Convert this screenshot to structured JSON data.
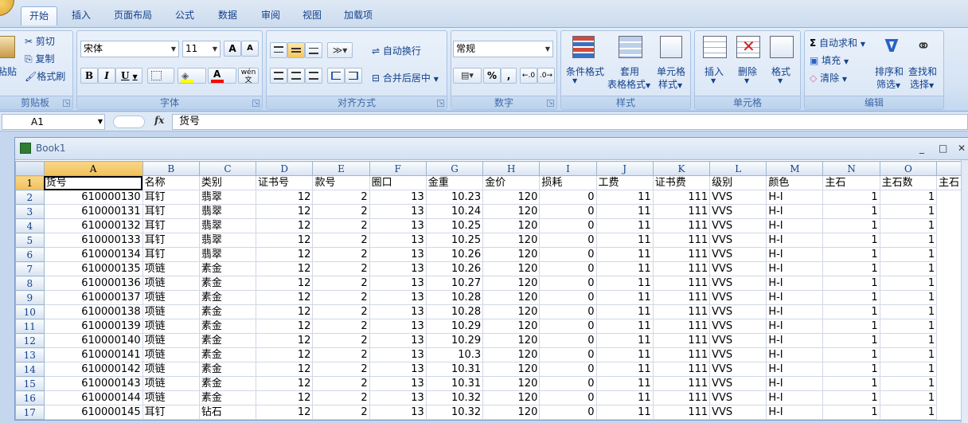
{
  "tabs": [
    "开始",
    "插入",
    "页面布局",
    "公式",
    "数据",
    "审阅",
    "视图",
    "加载项"
  ],
  "active_tab": "开始",
  "clipboard": {
    "paste": "粘贴",
    "cut": "剪切",
    "copy": "复制",
    "format_painter": "格式刷",
    "label": "剪贴板"
  },
  "font": {
    "name": "宋体",
    "size": "11",
    "bold": "B",
    "italic": "I",
    "underline": "U",
    "grow": "A",
    "shrink": "A",
    "wen": "wén",
    "label": "字体"
  },
  "alignment": {
    "wrap": "自动换行",
    "merge": "合并后居中",
    "label": "对齐方式"
  },
  "number": {
    "format": "常规",
    "percent": "%",
    "comma": ",",
    "label": "数字"
  },
  "styles": {
    "conditional": "条件格式",
    "table1": "套用",
    "table2": "表格格式",
    "cell1": "单元格",
    "cell2": "样式",
    "label": "样式"
  },
  "cells": {
    "insert": "插入",
    "delete": "删除",
    "format": "格式",
    "label": "单元格"
  },
  "editing": {
    "autosum": "自动求和",
    "fill": "填充",
    "clear": "清除",
    "sort1": "排序和",
    "sort2": "筛选",
    "find1": "查找和",
    "find2": "选择",
    "label": "编辑"
  },
  "formula_bar": {
    "name_box": "A1",
    "fx": "fx",
    "content": "货号"
  },
  "workbook": {
    "title": "Book1",
    "minimize": "_",
    "restore": "□"
  },
  "columns": [
    "A",
    "B",
    "C",
    "D",
    "E",
    "F",
    "G",
    "H",
    "I",
    "J",
    "K",
    "L",
    "M",
    "N",
    "O",
    ""
  ],
  "header_row": [
    "货号",
    "名称",
    "类别",
    "证书号",
    "款号",
    "圈口",
    "金重",
    "金价",
    "损耗",
    "工费",
    "证书费",
    "级别",
    "颜色",
    "主石",
    "主石数",
    "主石"
  ],
  "rows": [
    [
      "2",
      "610000130",
      "耳钉",
      "翡翠",
      "12",
      "2",
      "13",
      "10.23",
      "120",
      "0",
      "11",
      "111",
      "VVS",
      "H-I",
      "1",
      "1"
    ],
    [
      "3",
      "610000131",
      "耳钉",
      "翡翠",
      "12",
      "2",
      "13",
      "10.24",
      "120",
      "0",
      "11",
      "111",
      "VVS",
      "H-I",
      "1",
      "1"
    ],
    [
      "4",
      "610000132",
      "耳钉",
      "翡翠",
      "12",
      "2",
      "13",
      "10.25",
      "120",
      "0",
      "11",
      "111",
      "VVS",
      "H-I",
      "1",
      "1"
    ],
    [
      "5",
      "610000133",
      "耳钉",
      "翡翠",
      "12",
      "2",
      "13",
      "10.25",
      "120",
      "0",
      "11",
      "111",
      "VVS",
      "H-I",
      "1",
      "1"
    ],
    [
      "6",
      "610000134",
      "耳钉",
      "翡翠",
      "12",
      "2",
      "13",
      "10.26",
      "120",
      "0",
      "11",
      "111",
      "VVS",
      "H-I",
      "1",
      "1"
    ],
    [
      "7",
      "610000135",
      "项链",
      "素金",
      "12",
      "2",
      "13",
      "10.26",
      "120",
      "0",
      "11",
      "111",
      "VVS",
      "H-I",
      "1",
      "1"
    ],
    [
      "8",
      "610000136",
      "项链",
      "素金",
      "12",
      "2",
      "13",
      "10.27",
      "120",
      "0",
      "11",
      "111",
      "VVS",
      "H-I",
      "1",
      "1"
    ],
    [
      "9",
      "610000137",
      "项链",
      "素金",
      "12",
      "2",
      "13",
      "10.28",
      "120",
      "0",
      "11",
      "111",
      "VVS",
      "H-I",
      "1",
      "1"
    ],
    [
      "10",
      "610000138",
      "项链",
      "素金",
      "12",
      "2",
      "13",
      "10.28",
      "120",
      "0",
      "11",
      "111",
      "VVS",
      "H-I",
      "1",
      "1"
    ],
    [
      "11",
      "610000139",
      "项链",
      "素金",
      "12",
      "2",
      "13",
      "10.29",
      "120",
      "0",
      "11",
      "111",
      "VVS",
      "H-I",
      "1",
      "1"
    ],
    [
      "12",
      "610000140",
      "项链",
      "素金",
      "12",
      "2",
      "13",
      "10.29",
      "120",
      "0",
      "11",
      "111",
      "VVS",
      "H-I",
      "1",
      "1"
    ],
    [
      "13",
      "610000141",
      "项链",
      "素金",
      "12",
      "2",
      "13",
      "10.3",
      "120",
      "0",
      "11",
      "111",
      "VVS",
      "H-I",
      "1",
      "1"
    ],
    [
      "14",
      "610000142",
      "项链",
      "素金",
      "12",
      "2",
      "13",
      "10.31",
      "120",
      "0",
      "11",
      "111",
      "VVS",
      "H-I",
      "1",
      "1"
    ],
    [
      "15",
      "610000143",
      "项链",
      "素金",
      "12",
      "2",
      "13",
      "10.31",
      "120",
      "0",
      "11",
      "111",
      "VVS",
      "H-I",
      "1",
      "1"
    ],
    [
      "16",
      "610000144",
      "项链",
      "素金",
      "12",
      "2",
      "13",
      "10.32",
      "120",
      "0",
      "11",
      "111",
      "VVS",
      "H-I",
      "1",
      "1"
    ],
    [
      "17",
      "610000145",
      "耳钉",
      "钻石",
      "12",
      "2",
      "13",
      "10.32",
      "120",
      "0",
      "11",
      "111",
      "VVS",
      "H-I",
      "1",
      "1"
    ]
  ]
}
